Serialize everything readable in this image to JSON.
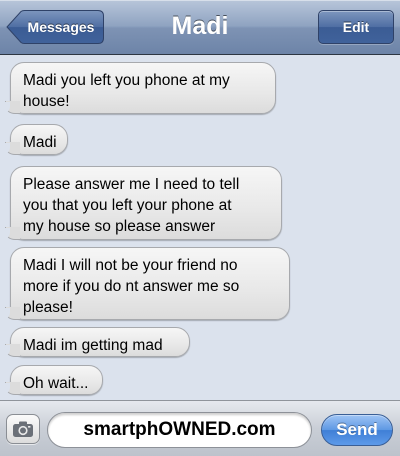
{
  "header": {
    "title": "Madi",
    "back_label": "Messages",
    "edit_label": "Edit"
  },
  "messages": [
    {
      "text": "Madi you left you phone at my\nhouse!"
    },
    {
      "text": "Madi"
    },
    {
      "text": "Please answer me I need to tell\nyou that you left your phone at\nmy house so please answer"
    },
    {
      "text": "Madi I will not be your friend no\nmore if you do nt answer me so\nplease!"
    },
    {
      "text": "Madi im getting mad"
    },
    {
      "text": "Oh wait..."
    }
  ],
  "composer": {
    "field_text": "smartphOWNED.com",
    "send_label": "Send",
    "camera_icon": "camera-icon"
  },
  "colors": {
    "navbar": "#7e93b4",
    "background": "#dbe2ed",
    "bubble": "#e8e8e8",
    "send": "#4f8cdf"
  }
}
